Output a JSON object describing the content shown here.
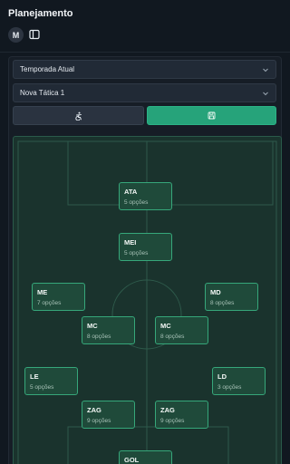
{
  "header": {
    "title": "Planejamento",
    "avatar_initial": "M"
  },
  "selects": {
    "season": "Temporada Atual",
    "tactic": "Nova Tática 1"
  },
  "icons": {
    "avatar": "avatar",
    "sidebar_toggle": "sidebar-panel-icon",
    "dropdown": "chevron-down-icon",
    "clear": "accessibility-icon",
    "save": "save-icon"
  },
  "colors": {
    "background": "#111820",
    "accent": "#26a37a",
    "pitch": "#1a332d",
    "card": "#1f4a3a",
    "card_border": "#36a77a"
  },
  "formation": [
    {
      "pos": "ATA",
      "options": "5 opções"
    },
    {
      "pos": "MEI",
      "options": "5 opções"
    },
    {
      "pos": "ME",
      "options": "7 opções"
    },
    {
      "pos": "MD",
      "options": "8 opções"
    },
    {
      "pos": "MC",
      "options": "8 opções"
    },
    {
      "pos": "MC",
      "options": "8 opções"
    },
    {
      "pos": "LE",
      "options": "5 opções"
    },
    {
      "pos": "LD",
      "options": "3 opções"
    },
    {
      "pos": "ZAG",
      "options": "9 opções"
    },
    {
      "pos": "ZAG",
      "options": "9 opções"
    },
    {
      "pos": "GOL",
      "options": ""
    }
  ]
}
